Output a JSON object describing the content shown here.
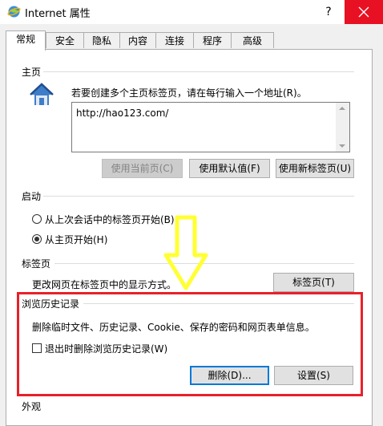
{
  "window": {
    "title": "Internet 属性",
    "help_label": "?"
  },
  "tabs": [
    {
      "label": "常规",
      "active": true
    },
    {
      "label": "安全"
    },
    {
      "label": "隐私"
    },
    {
      "label": "内容"
    },
    {
      "label": "连接"
    },
    {
      "label": "程序"
    },
    {
      "label": "高级"
    }
  ],
  "home": {
    "group_label": "主页",
    "instruction": "若要创建多个主页标签页，请在每行输入一个地址(R)。",
    "url_value": "http://hao123.com/",
    "btn_use_current": "使用当前页(C)",
    "btn_use_default": "使用默认值(F)",
    "btn_use_new_tab": "使用新标签页(U)"
  },
  "startup": {
    "group_label": "启动",
    "option_last_session": "从上次会话中的标签页开始(B)",
    "option_home": "从主页开始(H)",
    "selected": "home"
  },
  "tabs_section": {
    "group_label": "标签页",
    "description": "更改网页在标签页中的显示方式。",
    "btn_tabs": "标签页(T)"
  },
  "history": {
    "group_label": "浏览历史记录",
    "description": "删除临时文件、历史记录、Cookie、保存的密码和网页表单信息。",
    "checkbox_delete_on_exit": "退出时删除浏览历史记录(W)",
    "checkbox_checked": false,
    "btn_delete": "删除(D)...",
    "btn_settings": "设置(S)"
  },
  "appearance": {
    "group_label": "外观"
  },
  "colors": {
    "highlight_box": "#e8202a",
    "arrow": "#ffff33",
    "close_button": "#e81123"
  },
  "icons": {
    "window_icon": "internet-options-icon",
    "home_icon": "house-icon"
  }
}
